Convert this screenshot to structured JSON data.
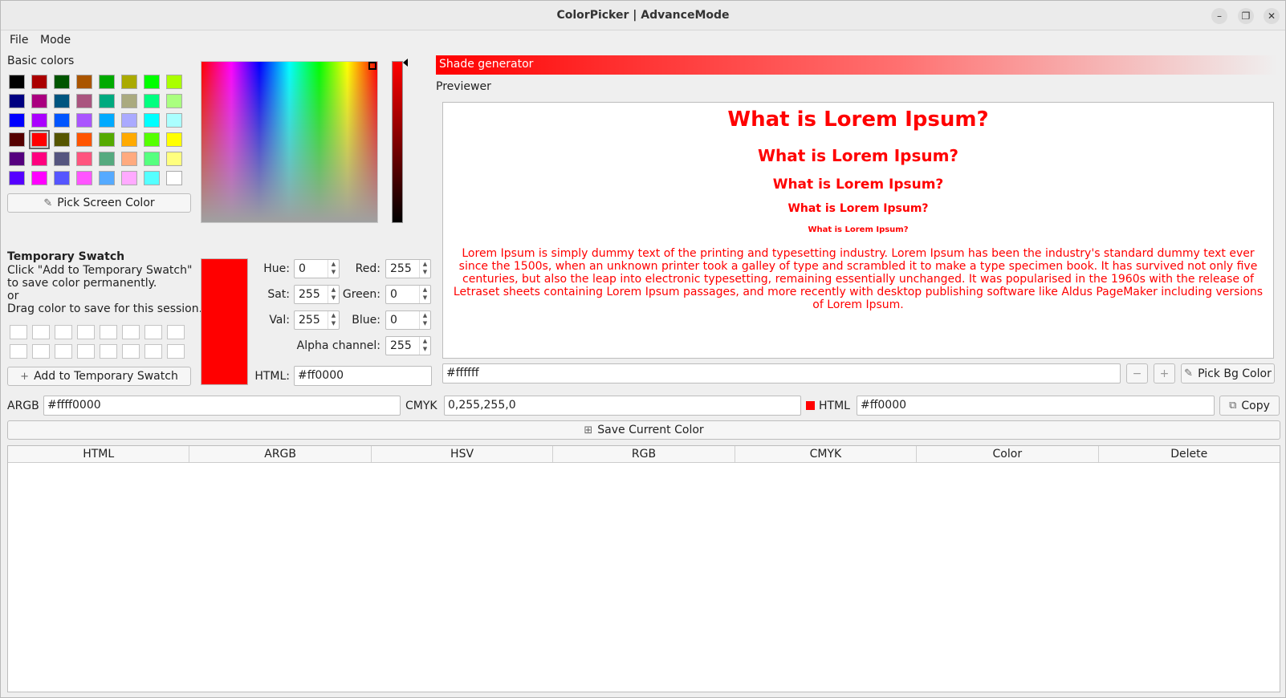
{
  "window": {
    "title": "ColorPicker | AdvanceMode"
  },
  "menu": [
    "File",
    "Mode"
  ],
  "basic_colors": {
    "label": "Basic colors",
    "rows": [
      [
        "#000000",
        "#aa0000",
        "#005500",
        "#aa5500",
        "#00aa00",
        "#aaaa00",
        "#00ff00",
        "#aaff00"
      ],
      [
        "#000080",
        "#aa007f",
        "#00557f",
        "#aa557f",
        "#00aa7f",
        "#aaaa7f",
        "#00ff7f",
        "#aaff7f"
      ],
      [
        "#0000ff",
        "#aa00ff",
        "#0055ff",
        "#aa55ff",
        "#00aaff",
        "#aaaaff",
        "#00ffff",
        "#aaffff"
      ],
      [
        "#550000",
        "#ff0000",
        "#555500",
        "#ff5500",
        "#55aa00",
        "#ffaa00",
        "#55ff00",
        "#ffff00"
      ],
      [
        "#55007f",
        "#ff007f",
        "#55557f",
        "#ff557f",
        "#55aa7f",
        "#ffaa7f",
        "#55ff7f",
        "#ffff7f"
      ],
      [
        "#5500ff",
        "#ff00ff",
        "#5555ff",
        "#ff55ff",
        "#55aaff",
        "#ffaaff",
        "#55ffff",
        "#ffffff"
      ]
    ],
    "selected": "#ff0000"
  },
  "pick_screen_button": "Pick Screen Color",
  "temp_swatch": {
    "title": "Temporary Swatch",
    "line1": "Click \"Add to Temporary Swatch\"",
    "line2": "to save color permanently.",
    "line3": "or",
    "line4": "Drag color to save for this session.",
    "add_button": "Add to Temporary Swatch"
  },
  "current_color": "#ff0000",
  "hsv": {
    "hue_label": "Hue:",
    "hue": "0",
    "sat_label": "Sat:",
    "sat": "255",
    "val_label": "Val:",
    "val": "255"
  },
  "rgb": {
    "red_label": "Red:",
    "red": "255",
    "green_label": "Green:",
    "green": "0",
    "blue_label": "Blue:",
    "blue": "0"
  },
  "alpha": {
    "label": "Alpha channel:",
    "value": "255"
  },
  "html_field": {
    "label": "HTML:",
    "value": "#ff0000"
  },
  "shade_generator": "Shade generator",
  "previewer": {
    "label": "Previewer",
    "heading": "What is Lorem Ipsum?",
    "paragraph": "Lorem Ipsum is simply dummy text of the printing and typesetting industry. Lorem Ipsum has been the industry's standard dummy text ever since the 1500s, when an unknown printer took a galley of type and scrambled it to make a type specimen book. It has survived not only five centuries, but also the leap into electronic typesetting, remaining essentially unchanged. It was popularised in the 1960s with the release of Letraset sheets containing Lorem Ipsum passages, and more recently with desktop publishing software like Aldus PageMaker including versions of Lorem Ipsum.",
    "bg_value": "#ffffff",
    "minus": "−",
    "plus": "+",
    "pick_bg_button": "Pick Bg Color"
  },
  "bottom": {
    "argb_label": "ARGB",
    "argb": "#ffff0000",
    "cmyk_label": "CMYK",
    "cmyk": "0,255,255,0",
    "html_label": "HTML",
    "html": "#ff0000",
    "copy_button": "Copy",
    "save_button": "Save Current Color"
  },
  "table": {
    "columns": [
      "HTML",
      "ARGB",
      "HSV",
      "RGB",
      "CMYK",
      "Color",
      "Delete"
    ]
  }
}
